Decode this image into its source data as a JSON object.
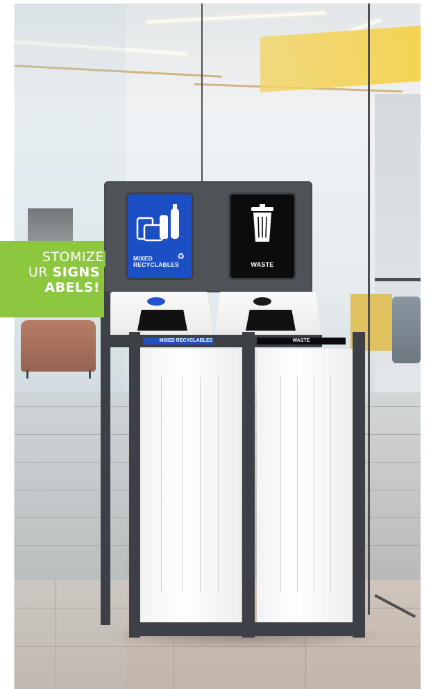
{
  "promo": {
    "line1": "STOMIZE",
    "line2_prefix": "UR ",
    "line2_bold": "SIGNS",
    "line3": "ABELS!",
    "color": "#8dc63f"
  },
  "signs": {
    "recycle_label_1": "MIXED",
    "recycle_label_2": "RECYCLABLES",
    "waste_label": "WASTE",
    "recycle_color": "#1d4fc4",
    "waste_color": "#0c0c0c"
  },
  "bins": {
    "left_strip_label": "MIXED RECYCLABLES",
    "right_strip_label": "WASTE"
  }
}
